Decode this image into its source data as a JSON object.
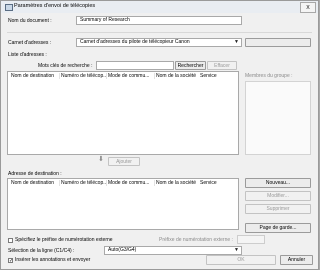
{
  "window": {
    "title": "Paramètres d'envoi de télécopies",
    "close_glyph": "x"
  },
  "document_name": {
    "label": "Nom du document :",
    "value": "Summary of Research"
  },
  "address_book": {
    "label": "Carnet d'adresses :",
    "selected": "Carnet d'adresses du pilote de télécopieur Canon"
  },
  "address_list": {
    "label": "Liste d'adresses :",
    "search_label": "Mots clés de recherche :",
    "search_button": "Rechercher",
    "clear_button": "Effacer",
    "columns": [
      "Nom de destination",
      "Numéro de télécop...",
      "Mode de commu...",
      "Nom de la société",
      "Service"
    ]
  },
  "group_members": {
    "label": "Membres du groupe :"
  },
  "add_button": "Ajouter",
  "destination": {
    "label": "Adresse de destination :",
    "columns": [
      "Nom de destination",
      "Numéro de télécop...",
      "Mode de commu...",
      "Nom de la société",
      "Service"
    ]
  },
  "side_buttons": {
    "new": "Nouveau...",
    "edit": "Modifier...",
    "delete": "Supprimer",
    "cover_page": "Page de garde..."
  },
  "dial_prefix": {
    "checkbox_label": "Spécifiez le préfixe de numérotation externe",
    "field_label": "Préfixe de numérotation externe :",
    "checked": false
  },
  "line_select": {
    "label": "Sélection de la ligne (C1/C4) :",
    "selected": "Auto(G3/G4)"
  },
  "insert_annotations": {
    "label": "Insérer les annotations et envoyer",
    "checked": true
  },
  "footer": {
    "ok": "OK",
    "cancel": "Annuler"
  }
}
